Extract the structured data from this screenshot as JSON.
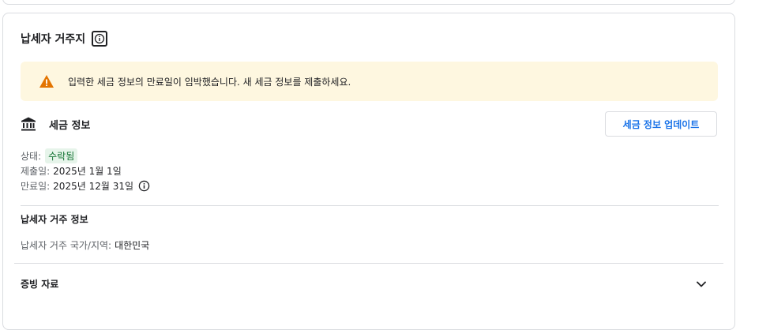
{
  "section": {
    "title": "납세자 거주지"
  },
  "warning": {
    "text": "입력한 세금 정보의 만료일이 임박했습니다. 새 세금 정보를 제출하세요."
  },
  "tax_info": {
    "label": "세금 정보",
    "update_button": "세금 정보 업데이트",
    "status_label": "상태:",
    "status_value": "수락됨",
    "submitted_label": "제출일:",
    "submitted_value": "2025년 1월 1일",
    "expiry_label": "만료일:",
    "expiry_value": "2025년 12월 31일"
  },
  "residency": {
    "title": "납세자 거주 정보",
    "country_label": "납세자 거주 국가/지역:",
    "country_value": "대한민국"
  },
  "evidence": {
    "title": "증빙 자료"
  },
  "colors": {
    "warning_bg": "#fef7e0",
    "warning_icon": "#e37400",
    "accent": "#1a73e8",
    "status_bg": "#e6f4ea",
    "status_text": "#137333"
  },
  "icons": {
    "title_info": "info-icon",
    "warning": "warning-triangle-icon",
    "tax": "bank-icon",
    "expiry_info": "info-icon",
    "evidence_toggle": "chevron-down-icon"
  }
}
